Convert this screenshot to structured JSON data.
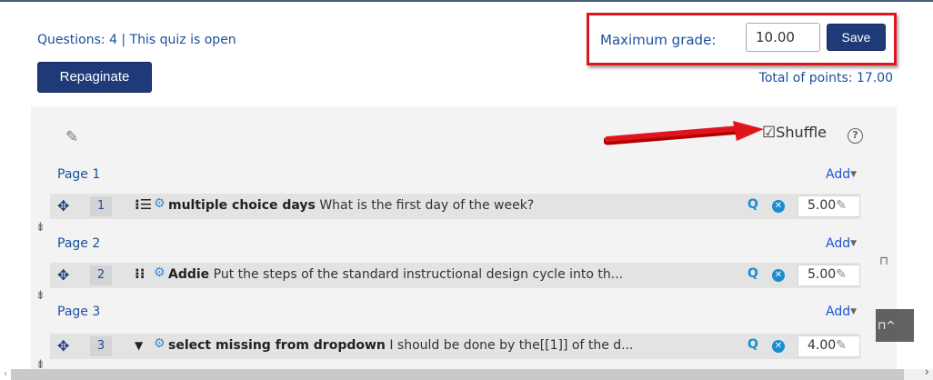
{
  "header": {
    "questions_info": "Questions: 4 | This quiz is open",
    "repaginate_label": "Repaginate",
    "max_grade_label": "Maximum grade:",
    "max_grade_value": "10.00",
    "save_label": "Save",
    "total_points": "Total of points: 17.00"
  },
  "section": {
    "edit_icon": "pencil-icon",
    "shuffle_checkbox": "☑",
    "shuffle_label": "Shuffle",
    "help_icon": "?"
  },
  "pages": [
    {
      "label": "Page 1",
      "add_label": "Add",
      "question": {
        "slot": "1",
        "type_icon": "⁝☰",
        "name": "multiple choice days",
        "text": " What is the first day of the week?",
        "mark": "5.00"
      }
    },
    {
      "label": "Page 2",
      "add_label": "Add",
      "question": {
        "slot": "2",
        "type_icon": "⁝⁝",
        "name": "Addie",
        "text": " Put the steps of the standard instructional design  cycle into th...",
        "mark": "5.00"
      }
    },
    {
      "label": "Page 3",
      "add_label": "Add",
      "question": {
        "slot": "3",
        "type_icon": "▼",
        "name": "select missing from dropdown",
        "text": " I should be done by the[[1]] of the d...",
        "mark": "4.00"
      }
    }
  ],
  "icons": {
    "move": "✥",
    "gear": "⚙",
    "preview": "Q",
    "delete": "✕",
    "pencil": "✎",
    "page_break": "⇟",
    "lock": "🔓",
    "caret": "▼"
  },
  "colors": {
    "primary_button": "#1e3a78",
    "link": "#1b4f9c",
    "highlight_box": "#e0141d",
    "annotation_arrow": "#e0141d"
  }
}
